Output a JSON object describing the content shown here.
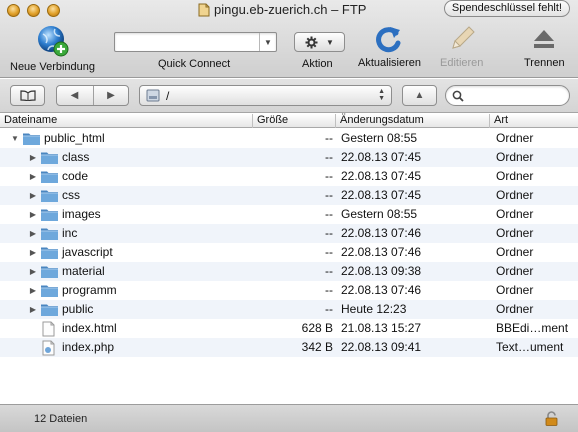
{
  "window": {
    "title": "pingu.eb-zuerich.ch – FTP",
    "key_badge": "Spendeschlüssel fehlt!"
  },
  "toolbar": {
    "new_connection_label": "Neue Verbindung",
    "quick_connect_label": "Quick Connect",
    "quick_connect_value": "",
    "action_label": "Aktion",
    "refresh_label": "Aktualisieren",
    "edit_label": "Editieren",
    "disconnect_label": "Trennen"
  },
  "pathbar": {
    "path": "/",
    "search_value": ""
  },
  "columns": {
    "name": "Dateiname",
    "size": "Größe",
    "date": "Änderungsdatum",
    "kind": "Art"
  },
  "rows": [
    {
      "name": "public_html",
      "size": "--",
      "date": "Gestern 08:55",
      "kind": "Ordner",
      "type": "folder",
      "depth": 0,
      "expanded": true
    },
    {
      "name": "class",
      "size": "--",
      "date": "22.08.13 07:45",
      "kind": "Ordner",
      "type": "folder",
      "depth": 1,
      "expanded": false
    },
    {
      "name": "code",
      "size": "--",
      "date": "22.08.13 07:45",
      "kind": "Ordner",
      "type": "folder",
      "depth": 1,
      "expanded": false
    },
    {
      "name": "css",
      "size": "--",
      "date": "22.08.13 07:45",
      "kind": "Ordner",
      "type": "folder",
      "depth": 1,
      "expanded": false
    },
    {
      "name": "images",
      "size": "--",
      "date": "Gestern 08:55",
      "kind": "Ordner",
      "type": "folder",
      "depth": 1,
      "expanded": false
    },
    {
      "name": "inc",
      "size": "--",
      "date": "22.08.13 07:46",
      "kind": "Ordner",
      "type": "folder",
      "depth": 1,
      "expanded": false
    },
    {
      "name": "javascript",
      "size": "--",
      "date": "22.08.13 07:46",
      "kind": "Ordner",
      "type": "folder",
      "depth": 1,
      "expanded": false
    },
    {
      "name": "material",
      "size": "--",
      "date": "22.08.13 09:38",
      "kind": "Ordner",
      "type": "folder",
      "depth": 1,
      "expanded": false
    },
    {
      "name": "programm",
      "size": "--",
      "date": "22.08.13 07:46",
      "kind": "Ordner",
      "type": "folder",
      "depth": 1,
      "expanded": false
    },
    {
      "name": "public",
      "size": "--",
      "date": "Heute 12:23",
      "kind": "Ordner",
      "type": "folder",
      "depth": 1,
      "expanded": false
    },
    {
      "name": "index.html",
      "size": "628 B",
      "date": "21.08.13 15:27",
      "kind": "BBEdi…ment",
      "type": "file-html",
      "depth": 1
    },
    {
      "name": "index.php",
      "size": "342 B",
      "date": "22.08.13 09:41",
      "kind": "Text…ument",
      "type": "file-php",
      "depth": 1
    }
  ],
  "status": {
    "count_text": "12 Dateien"
  },
  "colors": {
    "folder": "#6ea8dc",
    "folder_dark": "#4a86c0",
    "stripe": "#f0f4fa",
    "lock": "#d18a1a"
  },
  "icons": {
    "new_connection": "globe-plus-icon",
    "action": "gear-icon",
    "refresh": "refresh-icon",
    "edit": "pencil-icon",
    "disconnect": "eject-icon",
    "bookmarks": "book-icon",
    "back": "chevron-left-icon",
    "forward": "chevron-right-icon",
    "up": "arrow-up-icon",
    "search": "search-icon",
    "lock": "lock-icon"
  }
}
